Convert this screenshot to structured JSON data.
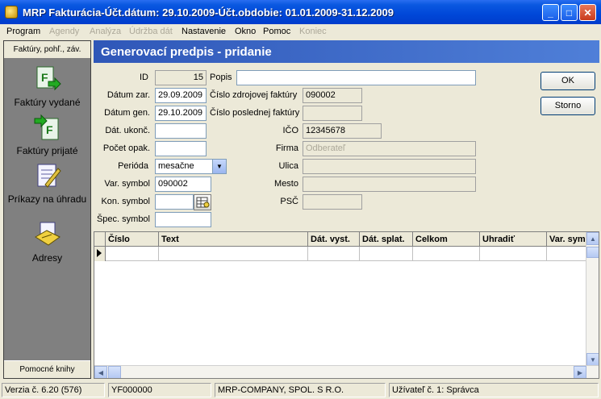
{
  "window": {
    "title": "MRP Fakturácia-Účt.dátum: 29.10.2009-Účt.obdobie: 01.01.2009-31.12.2009"
  },
  "menu": [
    "Program",
    "Agendy",
    "Analýza",
    "Údržba dát",
    "Nastavenie",
    "Okno",
    "Pomoc",
    "Koniec"
  ],
  "sidebar": {
    "top_label": "Faktúry, pohľ., záv.",
    "bottom_label": "Pomocné knihy",
    "items": [
      {
        "label": "Faktúry vydané",
        "icon": "invoice-issued-icon"
      },
      {
        "label": "Faktúry prijaté",
        "icon": "invoice-received-icon"
      },
      {
        "label": "Príkazy na úhradu",
        "icon": "payment-order-icon"
      },
      {
        "label": "Adresy",
        "icon": "address-book-icon"
      }
    ]
  },
  "form": {
    "header": "Generovací predpis  - pridanie",
    "id_label": "ID",
    "id_value": "15",
    "popis_label": "Popis",
    "popis_value": "",
    "datum_zar_label": "Dátum zar.",
    "datum_zar_value": "29.09.2009",
    "datum_gen_label": "Dátum gen.",
    "datum_gen_value": "29.10.2009",
    "dat_ukonc_label": "Dát. ukonč.",
    "dat_ukonc_value": "",
    "pocet_opak_label": "Počet opak.",
    "pocet_opak_value": "",
    "perioda_label": "Perióda",
    "perioda_value": "mesačne",
    "var_symbol_label": "Var. symbol",
    "var_symbol_value": "090002",
    "kon_symbol_label": "Kon. symbol",
    "kon_symbol_value": "",
    "spec_symbol_label": "Špec. symbol",
    "spec_symbol_value": "",
    "cislo_zdroj_label": "Číslo zdrojovej faktúry",
    "cislo_zdroj_value": "090002",
    "cislo_posl_label": "Číslo poslednej faktúry",
    "cislo_posl_value": "",
    "ico_label": "IČO",
    "ico_value": "12345678",
    "firma_label": "Firma",
    "firma_value": "Odberateľ",
    "ulica_label": "Ulica",
    "ulica_value": "",
    "mesto_label": "Mesto",
    "mesto_value": "",
    "psc_label": "PSČ",
    "psc_value": "",
    "ok_label": "OK",
    "storno_label": "Storno"
  },
  "grid": {
    "columns": [
      "Číslo",
      "Text",
      "Dát. vyst.",
      "Dát. splat.",
      "Celkom",
      "Uhradiť",
      "Var. symb"
    ]
  },
  "status": {
    "version": "Verzia č. 6.20 (576)",
    "code": "YF000000",
    "company": "MRP-COMPANY, SPOL. S R.O.",
    "user": "Užívateľ č. 1: Správca"
  }
}
